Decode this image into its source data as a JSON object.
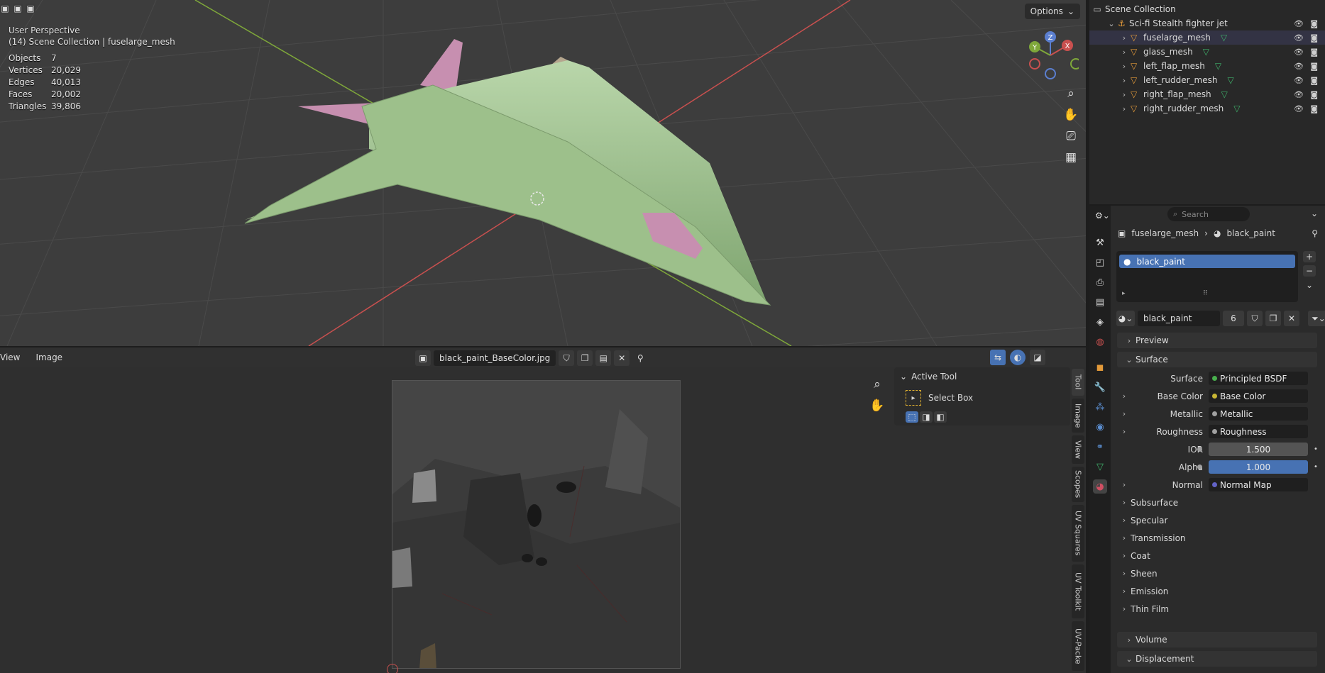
{
  "viewport": {
    "perspective": "User Perspective",
    "collection_line": "(14) Scene Collection | fuselarge_mesh",
    "stats": [
      {
        "label": "Objects",
        "value": "7"
      },
      {
        "label": "Vertices",
        "value": "20,029"
      },
      {
        "label": "Edges",
        "value": "40,013"
      },
      {
        "label": "Faces",
        "value": "20,002"
      },
      {
        "label": "Triangles",
        "value": "39,806"
      }
    ],
    "options_label": "Options",
    "gizmo": {
      "x": "X",
      "y": "Y",
      "z": "Z"
    },
    "colors": {
      "model": "#9dc08b",
      "accent_pink": "#c78fb0",
      "x_axis": "#c9504f",
      "y_axis": "#7fa83a"
    }
  },
  "image_editor": {
    "menu": [
      "View",
      "Image"
    ],
    "image_name": "black_paint_BaseColor.jpg",
    "active_tool": {
      "header": "Active Tool",
      "tool_name": "Select Box"
    },
    "side_tabs": [
      "Tool",
      "Image",
      "View",
      "Scopes",
      "UV Squares",
      "UV Toolkit",
      "UV-Packe"
    ]
  },
  "outliner": {
    "header": "Scene Collection",
    "root": "Sci-fi Stealth fighter jet",
    "items": [
      "fuselarge_mesh",
      "glass_mesh",
      "left_flap_mesh",
      "left_rudder_mesh",
      "right_flap_mesh",
      "right_rudder_mesh"
    ]
  },
  "properties": {
    "search_placeholder": "Search",
    "breadcrumb": {
      "object": "fuselarge_mesh",
      "material": "black_paint"
    },
    "slot": "black_paint",
    "material_name": "black_paint",
    "user_count": "6",
    "sections": {
      "preview": "Preview",
      "surface": "Surface",
      "volume": "Volume",
      "displacement": "Displacement"
    },
    "surface_rows": [
      {
        "label": "Surface",
        "value": "Principled BSDF",
        "dot": "#48b04d",
        "expand": false,
        "style": "dark"
      },
      {
        "label": "Base Color",
        "value": "Base Color",
        "dot": "#c8b634",
        "expand": true,
        "style": "dark"
      },
      {
        "label": "Metallic",
        "value": "Metallic",
        "dot": "#a0a0a0",
        "expand": true,
        "style": "dark"
      },
      {
        "label": "Roughness",
        "value": "Roughness",
        "dot": "#a0a0a0",
        "expand": true,
        "style": "dark"
      },
      {
        "label": "IOR",
        "value": "1.500",
        "dot": "#a0a0a0",
        "expand": false,
        "style": "gray"
      },
      {
        "label": "Alpha",
        "value": "1.000",
        "dot": "#a0a0a0",
        "expand": false,
        "style": "blue"
      },
      {
        "label": "Normal",
        "value": "Normal Map",
        "dot": "#6363c7",
        "expand": true,
        "style": "dark"
      }
    ],
    "subpanels": [
      "Subsurface",
      "Specular",
      "Transmission",
      "Coat",
      "Sheen",
      "Emission",
      "Thin Film"
    ]
  }
}
